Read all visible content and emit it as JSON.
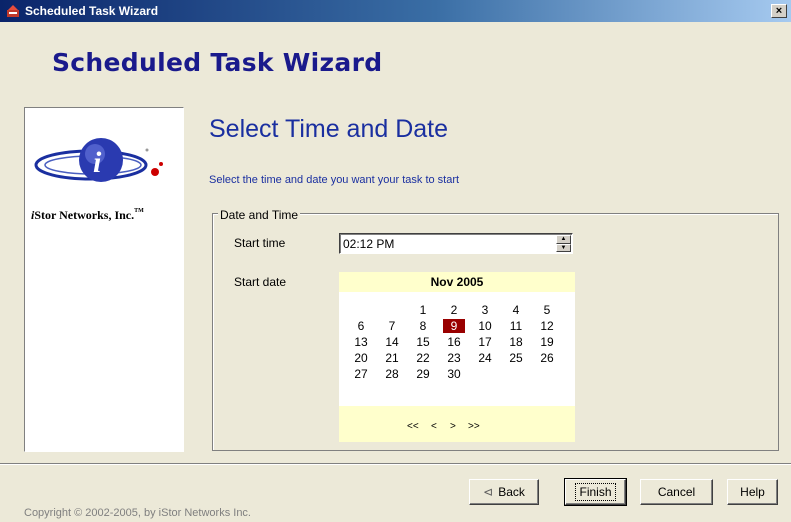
{
  "window": {
    "title": "Scheduled Task Wizard",
    "close_label": "×"
  },
  "banner": {
    "title": "Scheduled Task Wizard"
  },
  "logo": {
    "company_italic": "i",
    "company_rest": "Stor Networks, Inc.",
    "tm": "TM"
  },
  "main": {
    "heading": "Select Time and Date",
    "instruction": "Select the time and date you want your task to start"
  },
  "group": {
    "legend": "Date and Time",
    "start_time_label": "Start time",
    "start_time_value": "02:12 PM",
    "start_date_label": "Start date"
  },
  "calendar": {
    "month_year": "Nov 2005",
    "selected_day": "9",
    "days": [
      [
        "",
        "",
        "1",
        "2",
        "3",
        "4",
        "5"
      ],
      [
        "6",
        "7",
        "8",
        "9",
        "10",
        "11",
        "12"
      ],
      [
        "13",
        "14",
        "15",
        "16",
        "17",
        "18",
        "19"
      ],
      [
        "20",
        "21",
        "22",
        "23",
        "24",
        "25",
        "26"
      ],
      [
        "27",
        "28",
        "29",
        "30",
        "",
        "",
        ""
      ]
    ],
    "nav": {
      "prev_year": "<<",
      "prev_month": "<",
      "next_month": ">",
      "next_year": ">>"
    }
  },
  "buttons": {
    "back": "Back",
    "back_icon": "⊲",
    "finish": "Finish",
    "cancel": "Cancel",
    "help": "Help"
  },
  "footer": {
    "copyright": "Copyright © 2002-2005, by iStor Networks Inc."
  }
}
